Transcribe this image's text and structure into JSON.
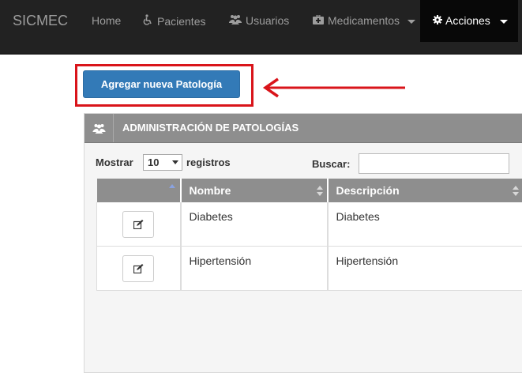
{
  "navbar": {
    "brand": "SICMEC",
    "items": [
      {
        "label": "Home",
        "icon": "none"
      },
      {
        "label": "Pacientes",
        "icon": "wheelchair-icon"
      },
      {
        "label": "Usuarios",
        "icon": "users-icon"
      },
      {
        "label": "Medicamentos",
        "icon": "medkit-icon",
        "dropdown": true
      },
      {
        "label": "Acciones",
        "icon": "gear-icon",
        "dropdown": true,
        "active": true
      }
    ]
  },
  "add_button": {
    "label": "Agregar nueva Patología"
  },
  "annotation": {
    "color": "#d9141a"
  },
  "panel": {
    "title": "ADMINISTRACIÓN DE PATOLOGÍAS",
    "icon": "users-icon",
    "length": {
      "prefix": "Mostrar",
      "value": "10",
      "suffix": "registros"
    },
    "search": {
      "label": "Buscar:",
      "value": ""
    },
    "table": {
      "columns": [
        "",
        "Nombre",
        "Descripción"
      ],
      "rows": [
        {
          "nombre": "Diabetes",
          "descripcion": "Diabetes"
        },
        {
          "nombre": "Hipertensión",
          "descripcion": "Hipertensión"
        }
      ]
    }
  },
  "colors": {
    "navbar": "#222222",
    "primary": "#337ab7",
    "panel_header": "#8e8e8e"
  }
}
